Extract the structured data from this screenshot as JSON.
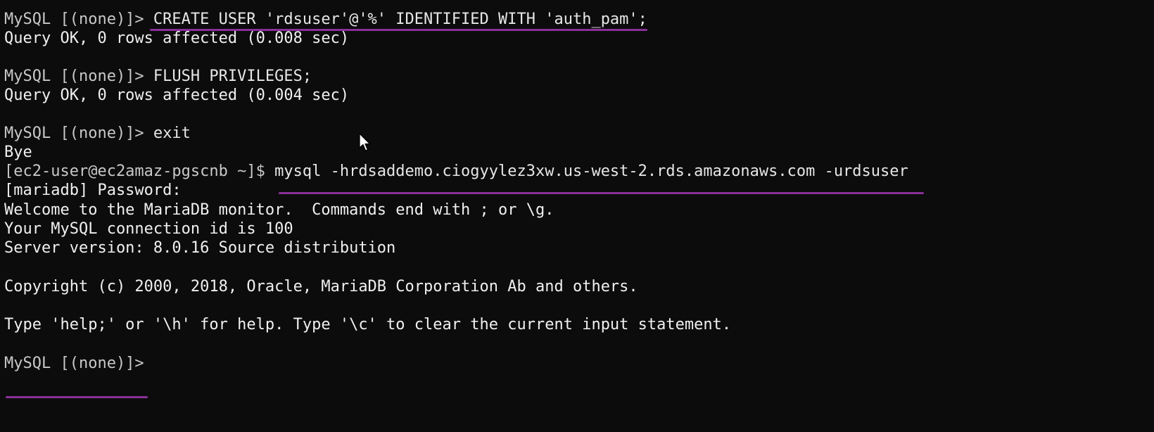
{
  "terminal": {
    "lines": [
      {
        "prompt": "MySQL [(none)]> ",
        "text": "CREATE USER 'rdsuser'@'%' IDENTIFIED WITH 'auth_pam';"
      },
      {
        "prompt": "",
        "text": "Query OK, 0 rows affected (0.008 sec)"
      },
      {
        "prompt": "",
        "text": ""
      },
      {
        "prompt": "MySQL [(none)]> ",
        "text": "FLUSH PRIVILEGES;"
      },
      {
        "prompt": "",
        "text": "Query OK, 0 rows affected (0.004 sec)"
      },
      {
        "prompt": "",
        "text": ""
      },
      {
        "prompt": "MySQL [(none)]> ",
        "text": "exit"
      },
      {
        "prompt": "",
        "text": "Bye"
      },
      {
        "prompt": "[ec2-user@ec2amaz-pgscnb ~]$ ",
        "text": "mysql -hrdsaddemo.ciogyylez3xw.us-west-2.rds.amazonaws.com -urdsuser"
      },
      {
        "prompt": "",
        "text": "[mariadb] Password:"
      },
      {
        "prompt": "",
        "text": "Welcome to the MariaDB monitor.  Commands end with ; or \\g."
      },
      {
        "prompt": "",
        "text": "Your MySQL connection id is 100"
      },
      {
        "prompt": "",
        "text": "Server version: 8.0.16 Source distribution"
      },
      {
        "prompt": "",
        "text": ""
      },
      {
        "prompt": "",
        "text": "Copyright (c) 2000, 2018, Oracle, MariaDB Corporation Ab and others."
      },
      {
        "prompt": "",
        "text": ""
      },
      {
        "prompt": "",
        "text": "Type 'help;' or '\\h' for help. Type '\\c' to clear the current input statement."
      },
      {
        "prompt": "",
        "text": ""
      },
      {
        "prompt": "MySQL [(none)]> ",
        "text": ""
      }
    ]
  },
  "colors": {
    "background": "#0c0c0c",
    "text": "#e8e8e8",
    "annotation_underline": "#8a2f9a"
  },
  "icons": {
    "mouse_pointer": "arrow-cursor-icon"
  }
}
